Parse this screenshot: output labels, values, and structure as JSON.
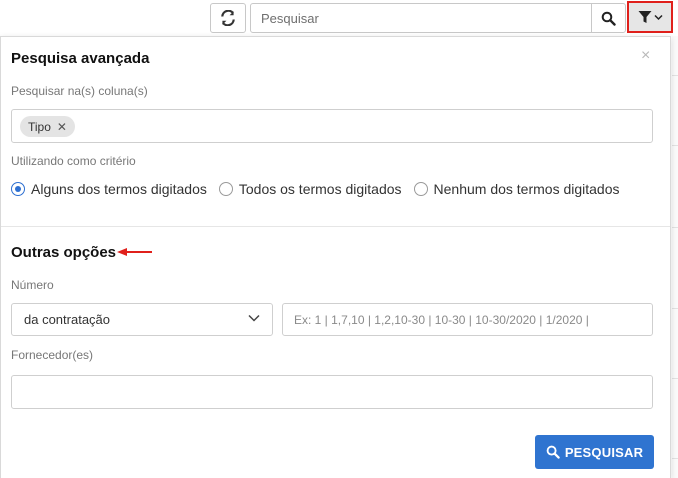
{
  "toolbar": {
    "refresh_icon": "refresh-icon",
    "search_placeholder": "Pesquisar",
    "search_icon": "search-icon",
    "filter_icon": "filter-icon",
    "highlight_color": "#e0201b"
  },
  "panel": {
    "close_glyph": "×",
    "advanced_title": "Pesquisa avançada",
    "columns_label": "Pesquisar na(s) coluna(s)",
    "column_tags": [
      {
        "label": "Tipo",
        "remove_glyph": "✕"
      }
    ],
    "criteria_label": "Utilizando como critério",
    "criteria_options": [
      {
        "label": "Alguns dos termos digitados",
        "checked": true
      },
      {
        "label": "Todos os termos digitados",
        "checked": false
      },
      {
        "label": "Nenhum dos termos digitados",
        "checked": false
      }
    ],
    "other_title": "Outras opções",
    "number_label": "Número",
    "number_select_value": "da contratação",
    "number_placeholder": "Ex: 1 | 1,7,10 | 1,2,10-30 | 10-30 | 10-30/2020 | 1/2020 |",
    "supplier_label": "Fornecedor(es)",
    "supplier_value": "",
    "search_button_label": "PESQUISAR",
    "accent_color": "#2f74d0",
    "annotation_arrow_color": "#e0201b"
  }
}
